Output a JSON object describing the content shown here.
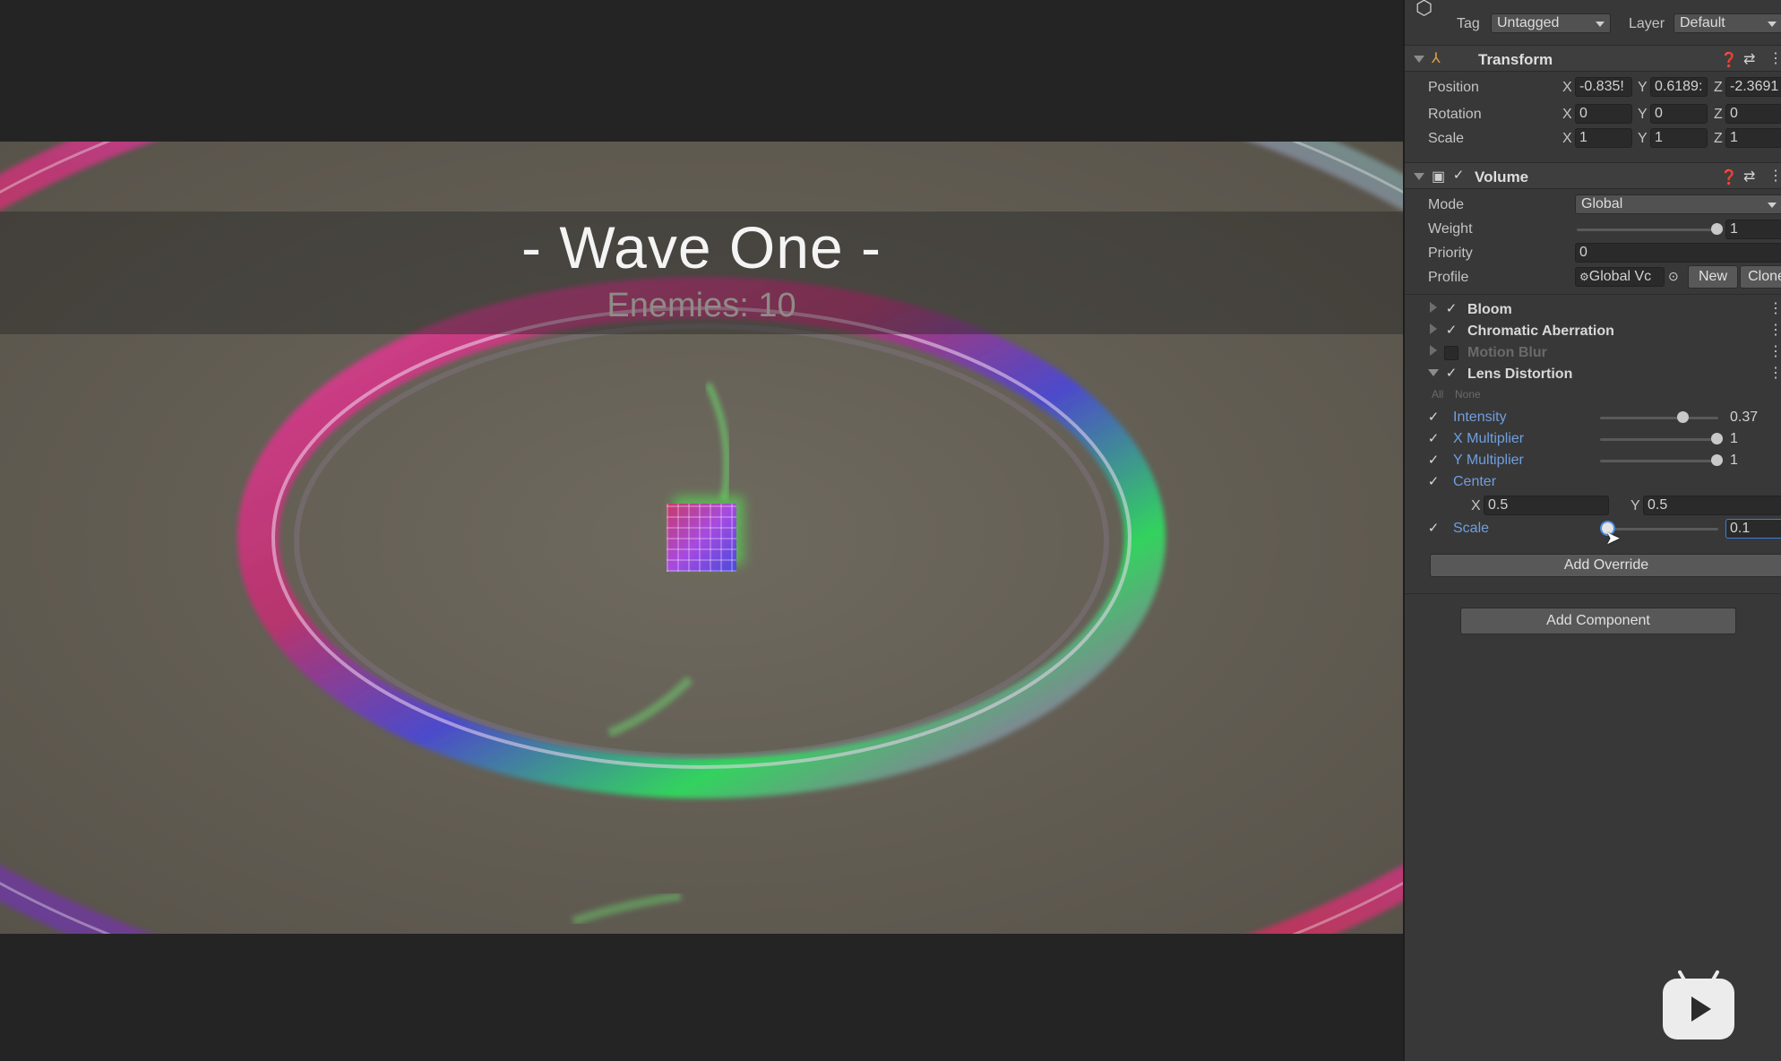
{
  "game": {
    "wave_title": "- Wave One -",
    "enemies_label": "Enemies: 10"
  },
  "inspector": {
    "header": {
      "tag_label": "Tag",
      "tag_value": "Untagged",
      "layer_label": "Layer",
      "layer_value": "Default"
    },
    "transform": {
      "title": "Transform",
      "position_label": "Position",
      "rotation_label": "Rotation",
      "scale_label": "Scale",
      "position": {
        "x": "-0.835!",
        "y": "0.6189:",
        "z": "-2.3691"
      },
      "rotation": {
        "x": "0",
        "y": "0",
        "z": "0"
      },
      "scale": {
        "x": "1",
        "y": "1",
        "z": "1"
      },
      "axis_x": "X",
      "axis_y": "Y",
      "axis_z": "Z"
    },
    "volume": {
      "title": "Volume",
      "mode_label": "Mode",
      "mode_value": "Global",
      "weight_label": "Weight",
      "weight_value": "1",
      "weight_fraction": 1.0,
      "priority_label": "Priority",
      "priority_value": "0",
      "profile_label": "Profile",
      "profile_value": "Global Vc",
      "new_button": "New",
      "clone_button": "Clone"
    },
    "effects": {
      "bloom": "Bloom",
      "chromatic": "Chromatic Aberration",
      "motion_blur": "Motion Blur",
      "lens_distortion": "Lens Distortion",
      "all": "All",
      "none": "None"
    },
    "lens": {
      "intensity_label": "Intensity",
      "intensity_value": "0.37",
      "intensity_fraction": 0.68,
      "x_mult_label": "X Multiplier",
      "x_mult_value": "1",
      "y_mult_label": "Y Multiplier",
      "y_mult_value": "1",
      "center_label": "Center",
      "center_x_label": "X",
      "center_x": "0.5",
      "center_y_label": "Y",
      "center_y": "0.5",
      "scale_label": "Scale",
      "scale_value": "0.1",
      "scale_fraction": 0.05
    },
    "add_override": "Add Override",
    "add_component": "Add Component"
  },
  "colors": {
    "inspector_bg": "#383838",
    "highlight_blue": "#6f9fe0",
    "viewport_bg": "#625d53"
  },
  "icons": [
    "gameobject-icon",
    "transform-icon",
    "volume-icon",
    "help-icon",
    "preset-icon",
    "kebab-menu-icon",
    "checkmark-icon",
    "foldout-arrow-icon",
    "cursor-icon",
    "bilibili-tv-icon"
  ]
}
